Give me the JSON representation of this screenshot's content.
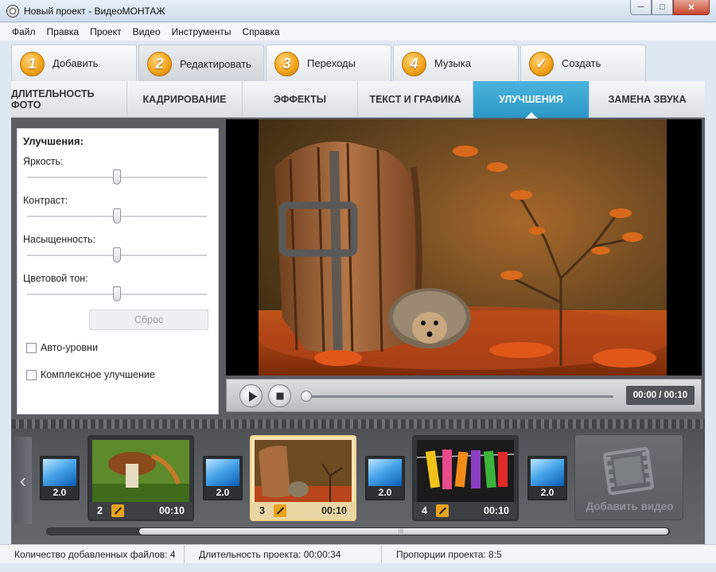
{
  "window": {
    "title": "Новый проект - ВидеоМОНТАЖ",
    "buttons": [
      "minimize",
      "maximize",
      "close"
    ]
  },
  "menu": [
    "Файл",
    "Правка",
    "Проект",
    "Видео",
    "Инструменты",
    "Справка"
  ],
  "steps": [
    {
      "num": "1",
      "label": "Добавить",
      "active": false
    },
    {
      "num": "2",
      "label": "Редактировать",
      "active": true
    },
    {
      "num": "3",
      "label": "Переходы",
      "active": false
    },
    {
      "num": "4",
      "label": "Музыка",
      "active": false
    },
    {
      "num": "✓",
      "label": "Создать",
      "active": false
    }
  ],
  "subtabs": [
    {
      "label": "ДЛИТЕЛЬНОСТЬ ФОТО",
      "active": false
    },
    {
      "label": "КАДРИРОВАНИЕ",
      "active": false
    },
    {
      "label": "ЭФФЕКТЫ",
      "active": false
    },
    {
      "label": "ТЕКСТ И ГРАФИКА",
      "active": false
    },
    {
      "label": "УЛУЧШЕНИЯ",
      "active": true
    },
    {
      "label": "ЗАМЕНА ЗВУКА",
      "active": false
    }
  ],
  "enhancements": {
    "title": "Улучшения:",
    "sliders": [
      {
        "label": "Яркость:",
        "value": 0.5
      },
      {
        "label": "Контраст:",
        "value": 0.5
      },
      {
        "label": "Насыщенность:",
        "value": 0.5
      },
      {
        "label": "Цветовой тон:",
        "value": 0.5
      }
    ],
    "reset_label": "Сброс",
    "checkboxes": [
      {
        "label": "Авто-уровни",
        "checked": false
      },
      {
        "label": "Комплексное улучшение",
        "checked": false
      }
    ]
  },
  "player": {
    "timecode": "00:00 / 00:10",
    "progress": 0
  },
  "timeline": {
    "clips": [
      {
        "num": "2",
        "duration": "00:10",
        "selected": false
      },
      {
        "num": "3",
        "duration": "00:10",
        "selected": true
      },
      {
        "num": "4",
        "duration": "00:10",
        "selected": false
      }
    ],
    "transitions": [
      "2.0",
      "2.0",
      "2.0",
      "2.0"
    ],
    "add_video_label": "Добавить видео"
  },
  "status": {
    "files": "Количество добавленных файлов: 4",
    "duration": "Длительность проекта:  00:00:34",
    "aspect": "Пропорции проекта:  8:5"
  },
  "colors": {
    "accent_tab": "#3aa6d3",
    "step_badge": "#f2a51b",
    "selected_clip": "#f2d38a"
  }
}
